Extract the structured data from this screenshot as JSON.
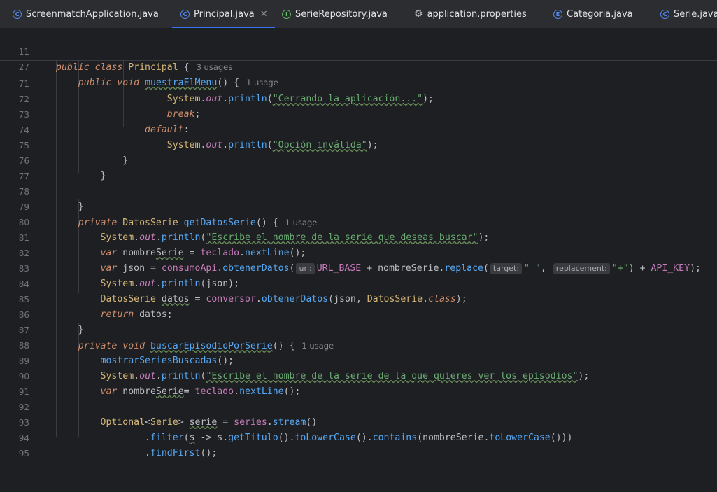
{
  "tabs": [
    {
      "label": "ScreenmatchApplication.java",
      "icon": "class-icon"
    },
    {
      "label": "Principal.java",
      "icon": "class-icon",
      "active": true
    },
    {
      "label": "SerieRepository.java",
      "icon": "interface-icon"
    },
    {
      "label": "application.properties",
      "icon": "gear-icon"
    },
    {
      "label": "Categoria.java",
      "icon": "enum-icon"
    },
    {
      "label": "Serie.java",
      "icon": "class-icon"
    }
  ],
  "sticky": {
    "l11": "11",
    "l27": "27",
    "usage11": "3 usages",
    "usage27": "1 usage"
  },
  "ln": {
    "l71": "71",
    "l72": "72",
    "l73": "73",
    "l74": "74",
    "l75": "75",
    "l76": "76",
    "l77": "77",
    "l78": "78",
    "l79": "79",
    "l80": "80",
    "l81": "81",
    "l82": "82",
    "l83": "83",
    "l84": "84",
    "l85": "85",
    "l86": "86",
    "l87": "87",
    "l88": "88",
    "l89": "89",
    "l90": "90",
    "l91": "91",
    "l92": "92",
    "l93": "93",
    "l94": "94",
    "l95": "95"
  },
  "usage": {
    "l79": "1 usage",
    "l87": "1 usage"
  },
  "hints": {
    "url": "url:",
    "target": "target:",
    "replacement": "replacement:"
  },
  "strings": {
    "cerrando": "\"Cerrando la aplicación...\"",
    "opcion": "\"Opción inválida\"",
    "escribe": "\"Escribe el nombre de la serie que deseas buscar\"",
    "space": "\" \"",
    "plus": "\"+\"",
    "episodios": "\"Escribe el nombre de la serie de la que quieres ver los episodios\""
  }
}
